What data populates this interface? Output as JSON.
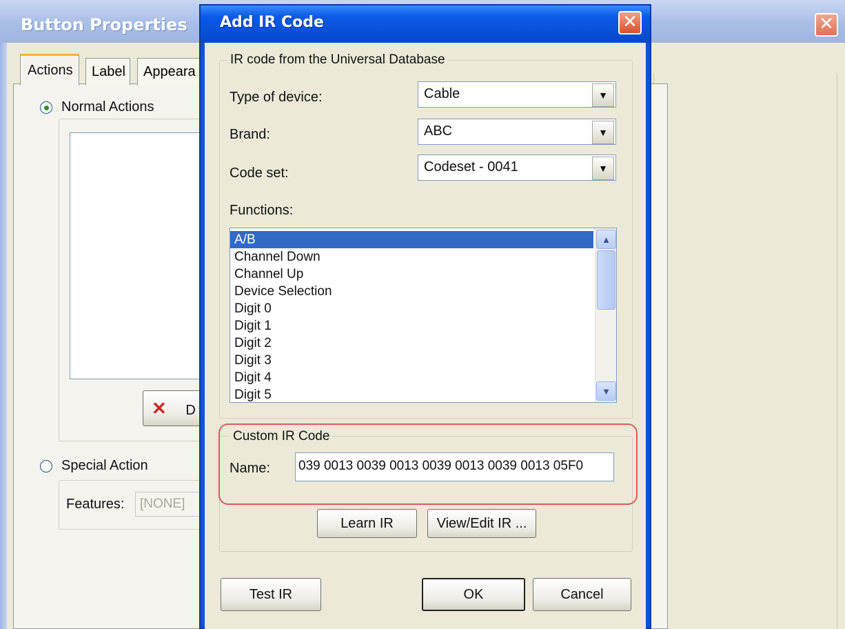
{
  "background_window": {
    "title": "Button Properties",
    "tabs": [
      "Actions",
      "Label",
      "Appeara"
    ],
    "normal_actions_label": "Normal Actions",
    "special_action_label": "Special Action",
    "features_label": "Features:",
    "features_value": "[NONE]",
    "delete_button_text": "D"
  },
  "dialog": {
    "title": "Add IR Code",
    "database_group_label": "IR code from the Universal Database",
    "type_of_device_label": "Type of device:",
    "type_of_device_value": "Cable",
    "brand_label": "Brand:",
    "brand_value": "ABC",
    "code_set_label": "Code set:",
    "code_set_value": "Codeset - 0041",
    "functions_label": "Functions:",
    "functions": [
      "A/B",
      "Channel Down",
      "Channel Up",
      "Device Selection",
      "Digit 0",
      "Digit 1",
      "Digit 2",
      "Digit 3",
      "Digit 4",
      "Digit 5"
    ],
    "selected_function": "A/B",
    "custom_group_label": "Custom IR Code",
    "name_label": "Name:",
    "name_value": "039 0013 0039 0013 0039 0013 0039 0013 05F0",
    "learn_button": "Learn IR",
    "view_edit_button": "View/Edit IR ...",
    "test_button": "Test IR",
    "ok_button": "OK",
    "cancel_button": "Cancel"
  },
  "colors": {
    "dialog_title_blue": "#0a4fd8",
    "selection_blue": "#316ac5",
    "highlight_red": "#de5a5a",
    "window_face": "#ece9d8"
  },
  "icons": {
    "close": "close-icon",
    "delete": "red-x-icon",
    "dropdown": "chevron-down-icon",
    "scroll_up": "scroll-up-arrow-icon",
    "scroll_down": "scroll-down-arrow-icon"
  }
}
